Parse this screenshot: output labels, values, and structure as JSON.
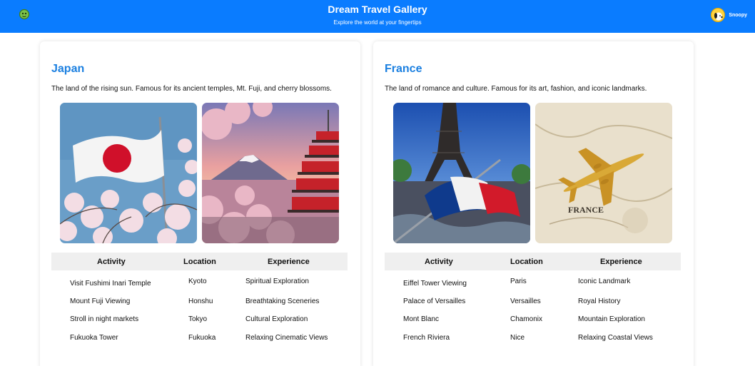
{
  "header": {
    "title": "Dream Travel Gallery",
    "subtitle": "Explore the world at your fingertips",
    "user_name": "Snoopy"
  },
  "table_headers": {
    "activity": "Activity",
    "location": "Location",
    "experience": "Experience"
  },
  "cards": [
    {
      "name": "Japan",
      "description": "The land of the rising sun. Famous for its ancient temples, Mt. Fuji, and cherry blossoms.",
      "rows": [
        {
          "activity": "Visit Fushimi Inari Temple",
          "location": "Kyoto",
          "experience": "Spiritual Exploration"
        },
        {
          "activity": "Mount Fuji Viewing",
          "location": "Honshu",
          "experience": "Breathtaking Sceneries"
        },
        {
          "activity": "Stroll in night markets",
          "location": "Tokyo",
          "experience": "Cultural Exploration"
        },
        {
          "activity": "Fukuoka Tower",
          "location": "Fukuoka",
          "experience": "Relaxing Cinematic Views"
        }
      ]
    },
    {
      "name": "France",
      "description": "The land of romance and culture. Famous for its art, fashion, and iconic landmarks.",
      "map_label": "FRANCE",
      "rows": [
        {
          "activity": "Eiffel Tower Viewing",
          "location": "Paris",
          "experience": "Iconic Landmark"
        },
        {
          "activity": "Palace of Versailles",
          "location": "Versailles",
          "experience": "Royal History"
        },
        {
          "activity": "Mont Blanc",
          "location": "Chamonix",
          "experience": "Mountain Exploration"
        },
        {
          "activity": "French Riviera",
          "location": "Nice",
          "experience": "Relaxing Coastal Views"
        }
      ]
    }
  ]
}
